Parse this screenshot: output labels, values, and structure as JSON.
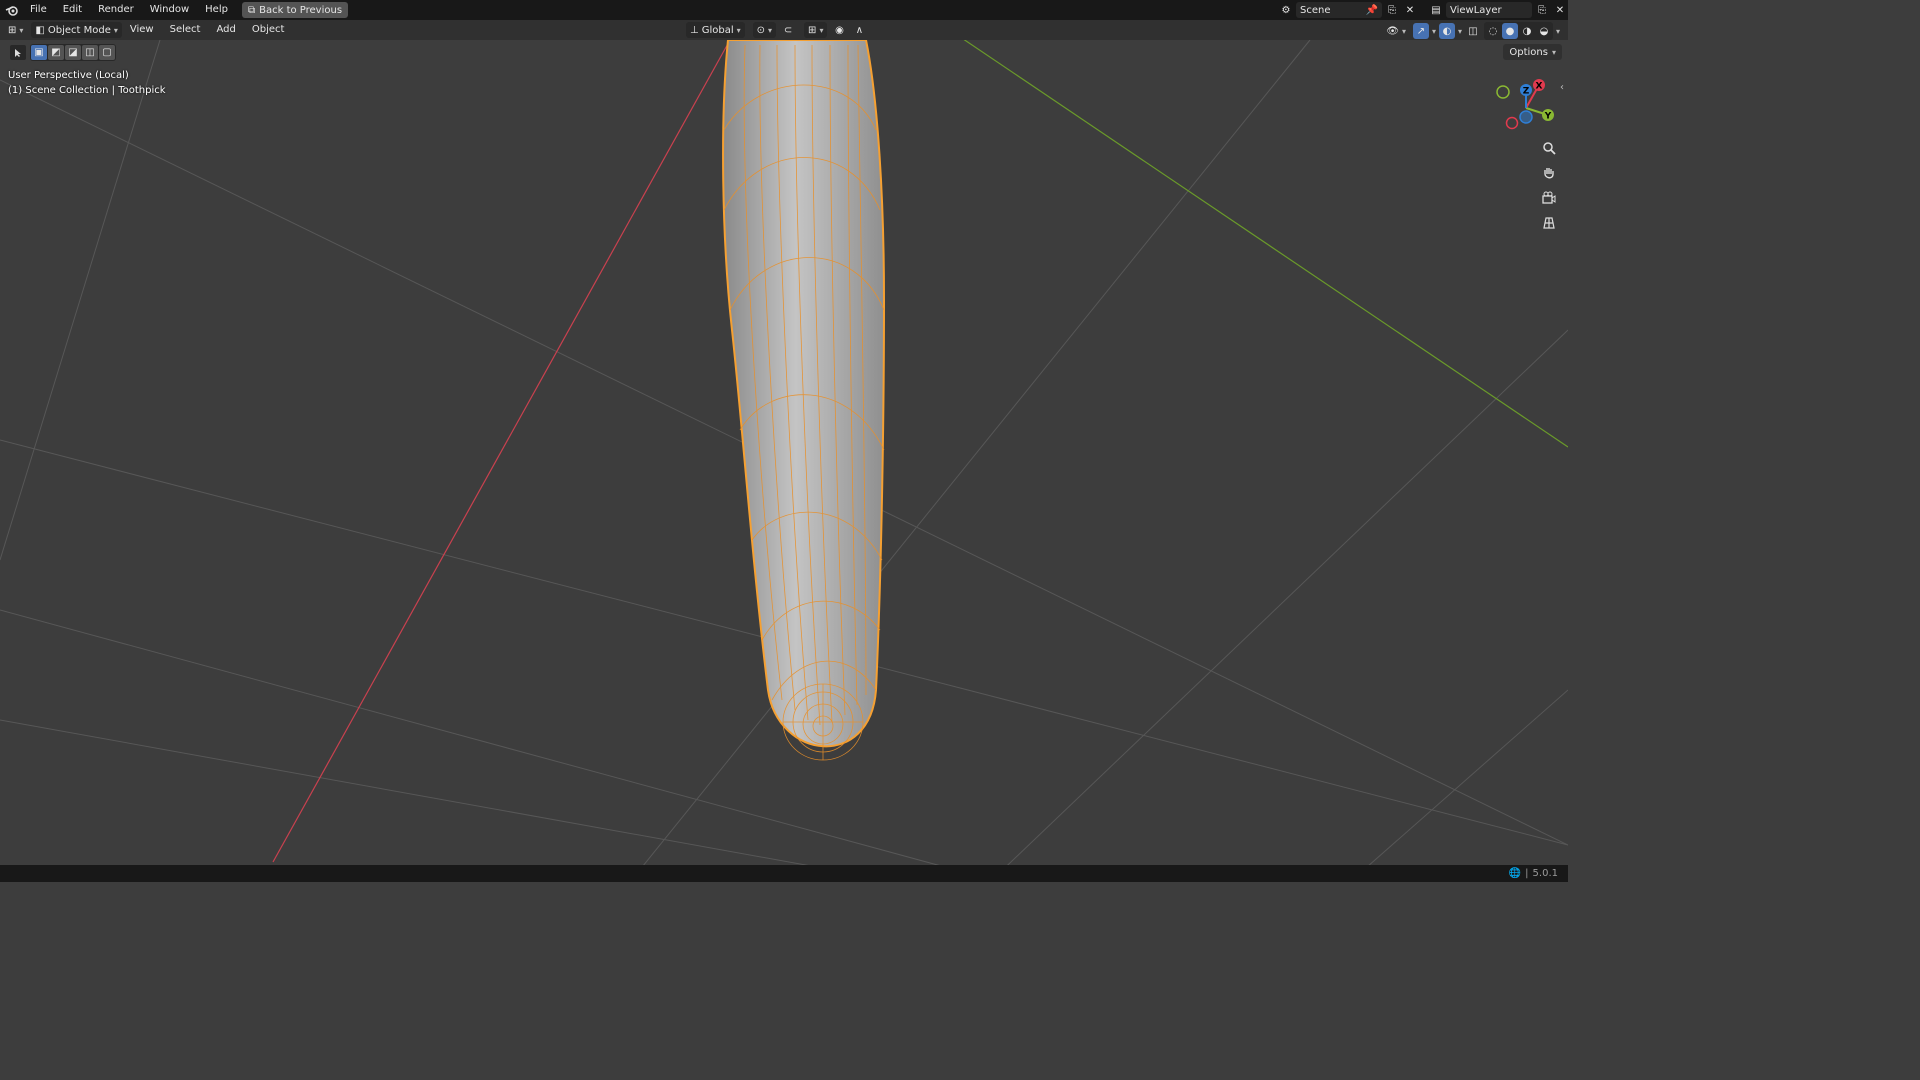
{
  "menubar": {
    "items": [
      "File",
      "Edit",
      "Render",
      "Window",
      "Help"
    ],
    "back_button": "Back to Previous",
    "scene": "Scene",
    "view_layer": "ViewLayer"
  },
  "viewport_header": {
    "mode": "Object Mode",
    "menus": [
      "View",
      "Select",
      "Add",
      "Object"
    ],
    "transform_orientation": "Global",
    "options_label": "Options"
  },
  "overlay": {
    "perspective": "User Perspective (Local)",
    "collection": "(1) Scene Collection | Toothpick"
  },
  "gizmo": {
    "x": "X",
    "y": "Y",
    "z": "Z"
  },
  "statusbar": {
    "version": "5.0.1"
  },
  "colors": {
    "background": "#3d3d3d",
    "grid": "#555555",
    "x_axis": "#c9414f",
    "y_axis": "#6a9a2a",
    "selection": "#f5a032",
    "mesh": "#a8a8a8"
  }
}
